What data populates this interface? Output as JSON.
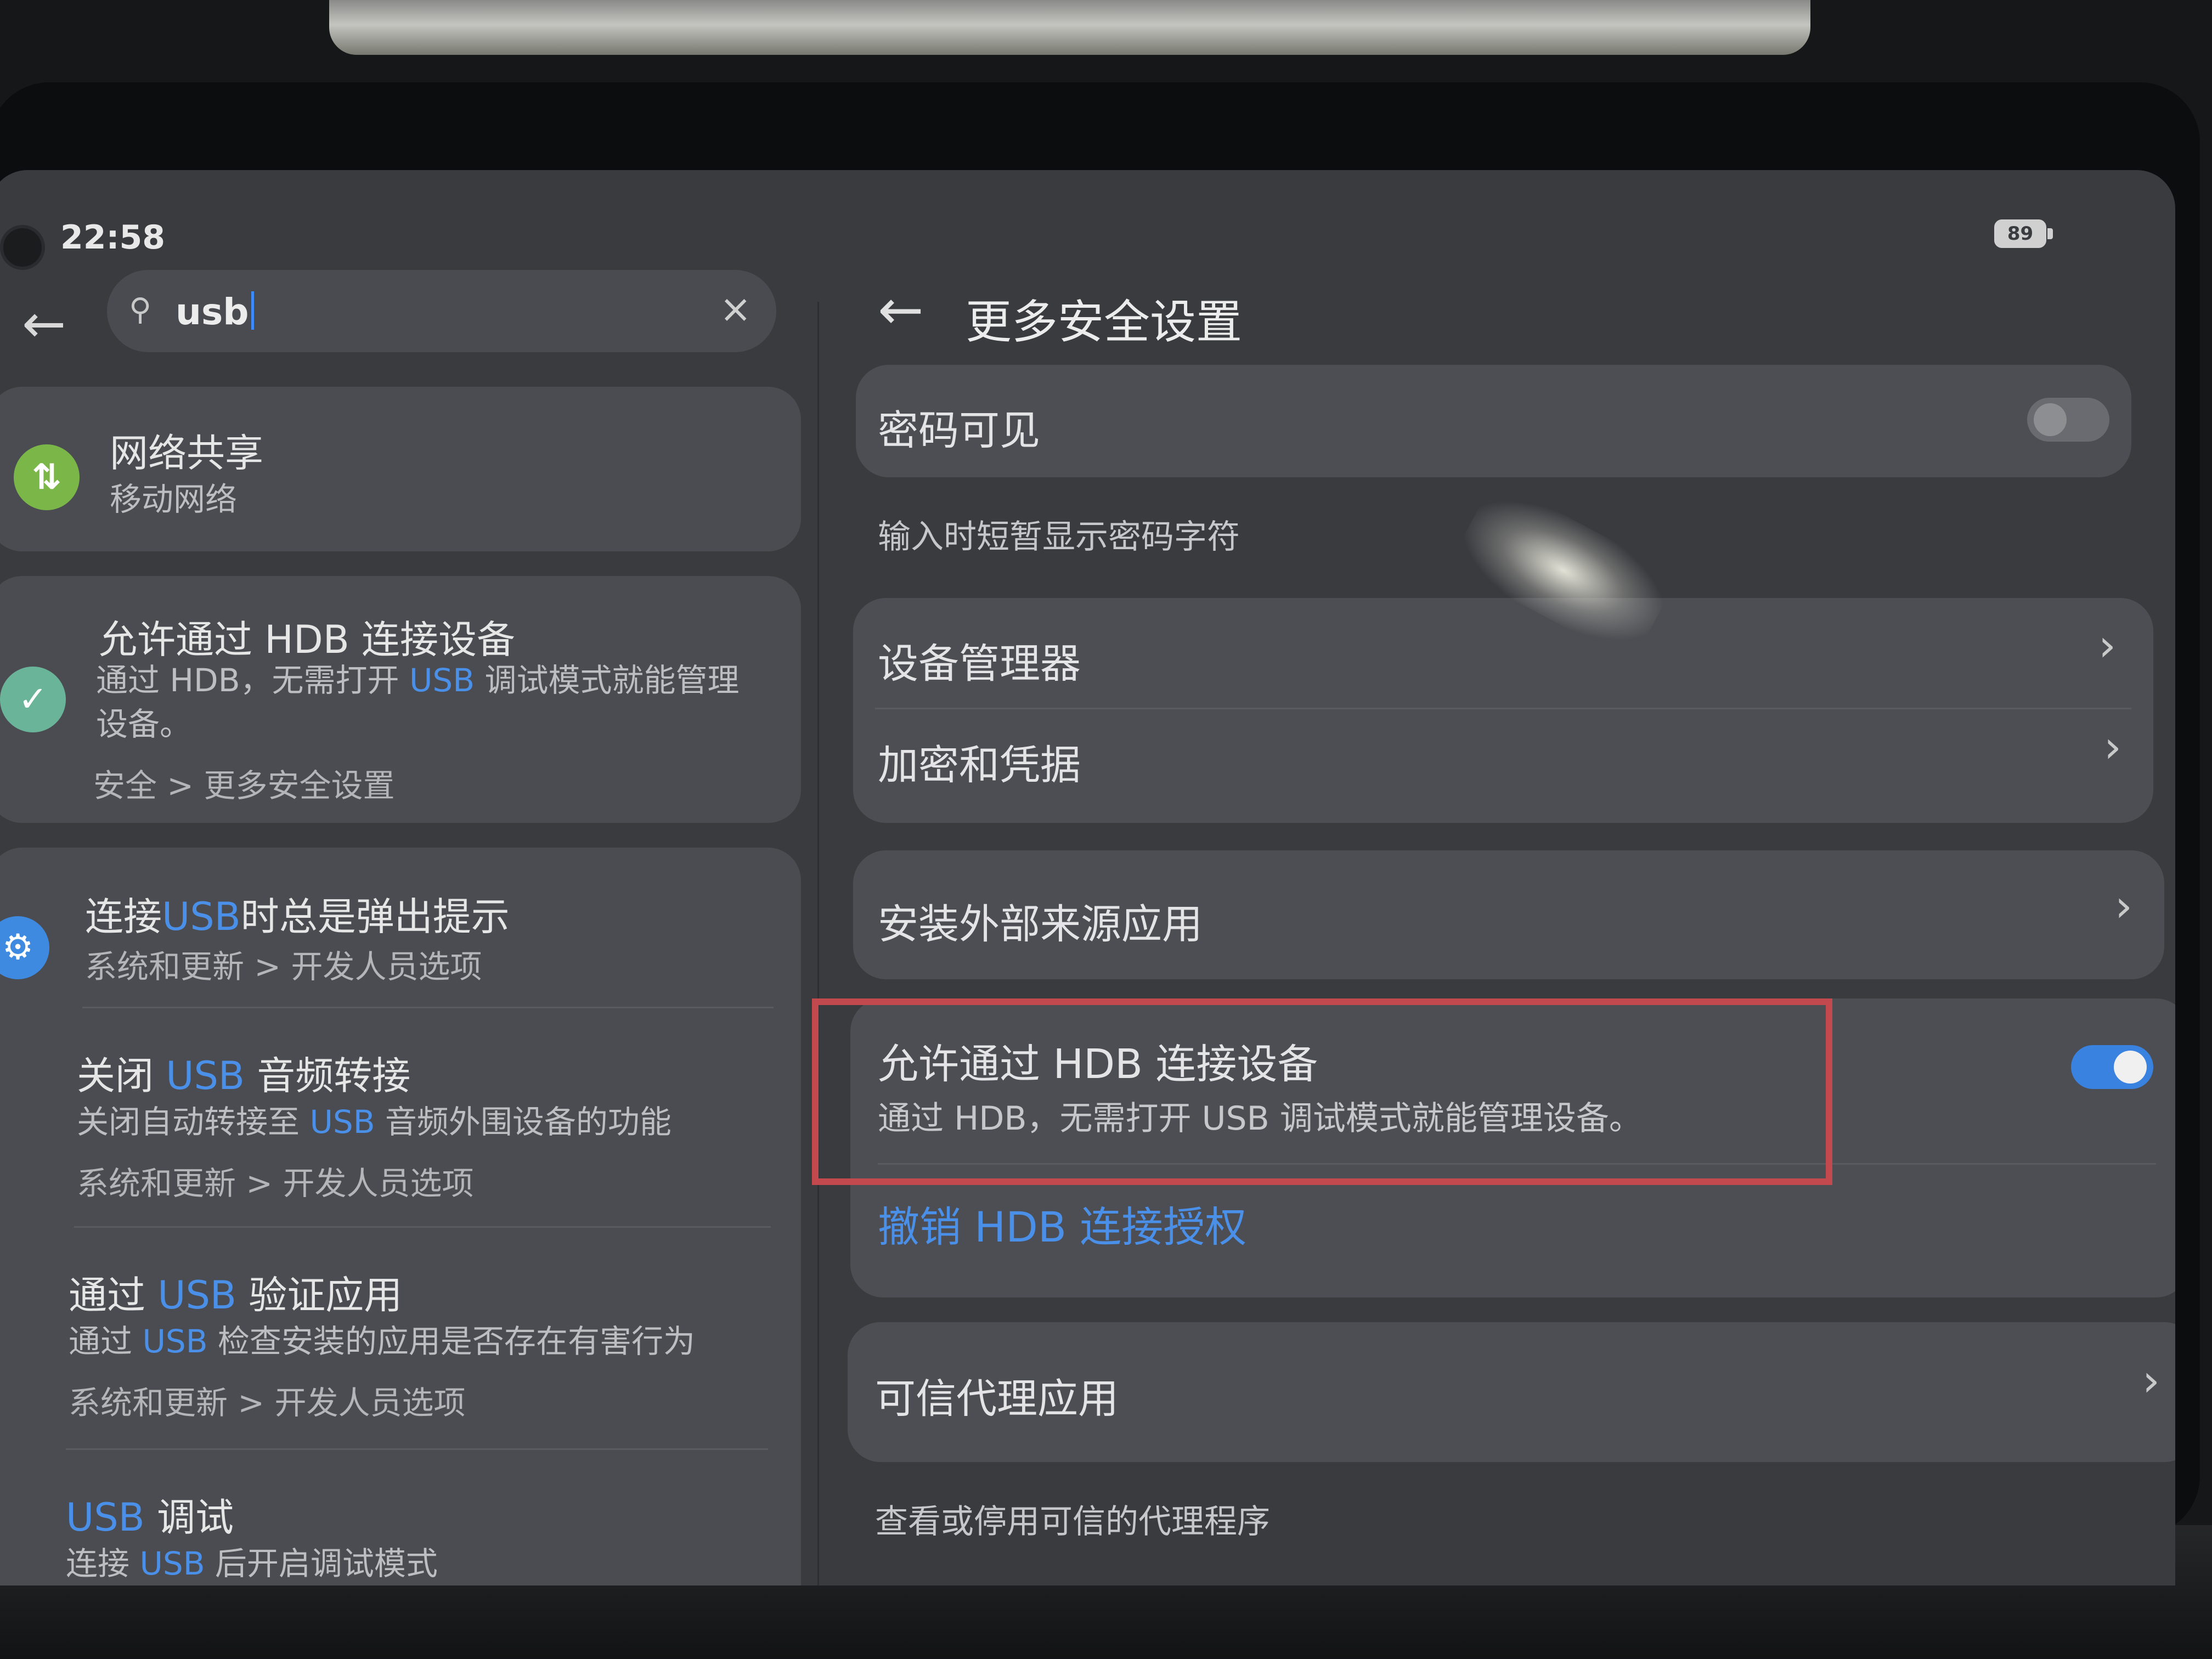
{
  "status_bar": {
    "time": "22:58",
    "battery": "89"
  },
  "search": {
    "query": "usb"
  },
  "results": [
    {
      "title": "网络共享",
      "subtitle": "移动网络",
      "icon": "tethering-icon",
      "icon_color": "#7ab648"
    },
    {
      "title": "允许通过 HDB 连接设备",
      "subtitle_pre": "通过 HDB，无需打开 ",
      "subtitle_hl": "USB",
      "subtitle_post": " 调试模式就能管理",
      "subtitle_line2": "设备。",
      "path": "安全 > 更多安全设置",
      "icon": "shield-icon",
      "icon_color": "#6ab59a"
    },
    {
      "title_pre": "连接",
      "title_hl": "USB",
      "title_post": "时总是弹出提示",
      "path": "系统和更新 > 开发人员选项",
      "icon": "gear-icon",
      "icon_color": "#3d8ae0"
    },
    {
      "title_pre": "关闭 ",
      "title_hl": "USB",
      "title_post": " 音频转接",
      "subtitle_pre": "关闭自动转接至 ",
      "subtitle_hl": "USB",
      "subtitle_post": " 音频外围设备的功能",
      "path": "系统和更新 > 开发人员选项"
    },
    {
      "title_pre": "通过 ",
      "title_hl": "USB",
      "title_post": " 验证应用",
      "subtitle_pre": "通过 ",
      "subtitle_hl": "USB",
      "subtitle_post": " 检查安装的应用是否存在有害行为",
      "path": "系统和更新 > 开发人员选项"
    },
    {
      "title_hl": "USB",
      "title_post": " 调试",
      "subtitle_pre": "连接 ",
      "subtitle_hl": "USB",
      "subtitle_post": " 后开启调试模式"
    }
  ],
  "detail": {
    "title": "更多安全设置",
    "password_visible": {
      "label": "密码可见",
      "desc": "输入时短暂显示密码字符",
      "enabled": false
    },
    "device_admin": {
      "label": "设备管理器"
    },
    "encryption": {
      "label": "加密和凭据"
    },
    "install_unknown": {
      "label": "安装外部来源应用"
    },
    "hdb": {
      "label": "允许通过 HDB 连接设备",
      "desc": "通过 HDB，无需打开 USB 调试模式就能管理设备。",
      "enabled": true
    },
    "revoke_hdb": {
      "label": "撤销 HDB 连接授权"
    },
    "trust_agents": {
      "label": "可信代理应用",
      "desc": "查看或停用可信的代理程序"
    }
  },
  "colors": {
    "accent": "#4a8fe8",
    "highlight_border": "#c24a4f"
  }
}
